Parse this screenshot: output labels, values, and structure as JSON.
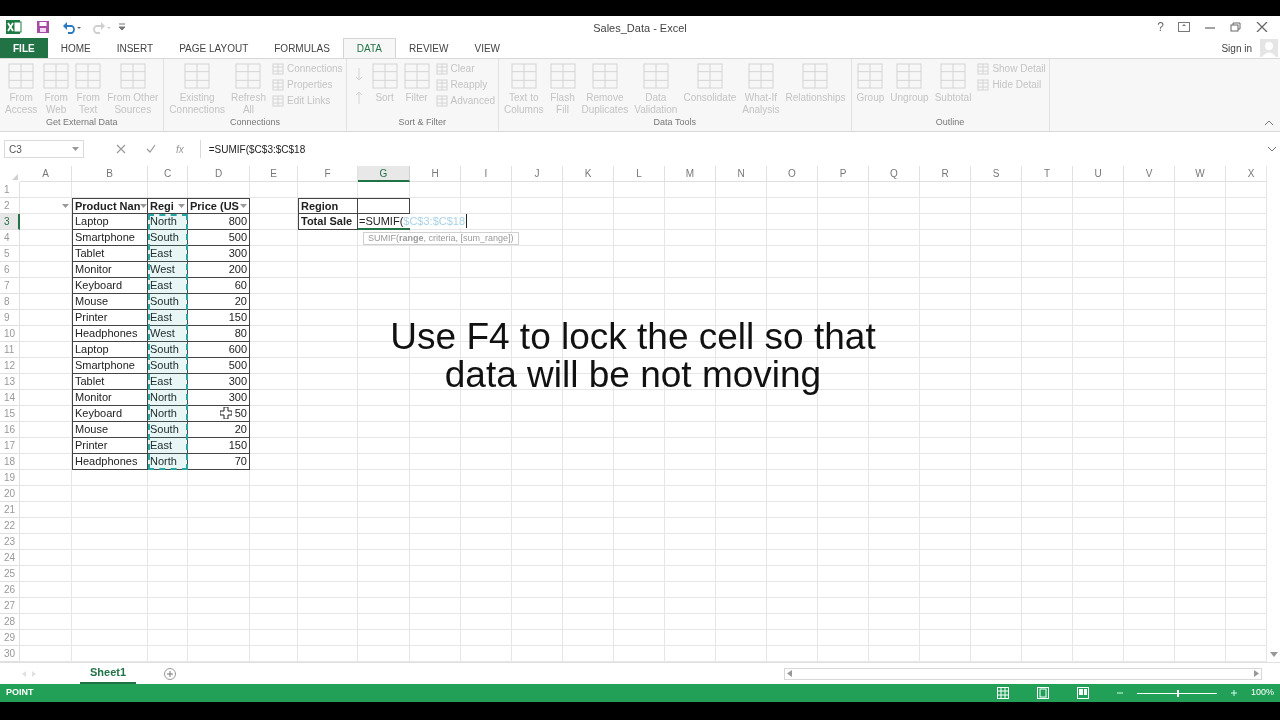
{
  "title_bar": {
    "title": "Sales_Data - Excel",
    "help": "?"
  },
  "ribbon_tabs": [
    {
      "label": "FILE",
      "kind": "file",
      "selected": false
    },
    {
      "label": "HOME",
      "kind": "tab",
      "selected": false
    },
    {
      "label": "INSERT",
      "kind": "tab",
      "selected": false
    },
    {
      "label": "PAGE LAYOUT",
      "kind": "tab",
      "selected": false
    },
    {
      "label": "FORMULAS",
      "kind": "tab",
      "selected": false
    },
    {
      "label": "DATA",
      "kind": "tab",
      "selected": true
    },
    {
      "label": "REVIEW",
      "kind": "tab",
      "selected": false
    },
    {
      "label": "VIEW",
      "kind": "tab",
      "selected": false
    }
  ],
  "sign_in": "Sign in",
  "ribbon_groups": [
    {
      "label": "Get External Data",
      "commands": [
        {
          "kind": "large",
          "label": "From\nAccess",
          "disabled": true
        },
        {
          "kind": "large",
          "label": "From\nWeb",
          "disabled": true
        },
        {
          "kind": "large",
          "label": "From\nText",
          "disabled": true
        },
        {
          "kind": "large",
          "label": "From Other\nSources",
          "disabled": true
        }
      ]
    },
    {
      "label": "Connections",
      "commands": [
        {
          "kind": "large",
          "label": "Existing\nConnections",
          "disabled": true
        },
        {
          "kind": "large",
          "label": "Refresh\nAll",
          "disabled": true
        },
        {
          "kind": "stack",
          "items": [
            {
              "label": "Connections",
              "disabled": true
            },
            {
              "label": "Properties",
              "disabled": true
            },
            {
              "label": "Edit Links",
              "disabled": true
            }
          ]
        }
      ]
    },
    {
      "label": "Sort & Filter",
      "commands": [
        {
          "kind": "sort_pair",
          "disabled": true
        },
        {
          "kind": "large",
          "label": "Sort",
          "disabled": true
        },
        {
          "kind": "large",
          "label": "Filter",
          "disabled": true
        },
        {
          "kind": "stack",
          "items": [
            {
              "label": "Clear",
              "disabled": true
            },
            {
              "label": "Reapply",
              "disabled": true
            },
            {
              "label": "Advanced",
              "disabled": true
            }
          ]
        }
      ]
    },
    {
      "label": "Data Tools",
      "commands": [
        {
          "kind": "large",
          "label": "Text to\nColumns",
          "disabled": true
        },
        {
          "kind": "large",
          "label": "Flash\nFill",
          "disabled": true
        },
        {
          "kind": "large",
          "label": "Remove\nDuplicates",
          "disabled": true
        },
        {
          "kind": "large",
          "label": "Data\nValidation",
          "disabled": true
        },
        {
          "kind": "large",
          "label": "Consolidate",
          "disabled": true
        },
        {
          "kind": "large",
          "label": "What-If\nAnalysis",
          "disabled": true
        },
        {
          "kind": "large",
          "label": "Relationships",
          "disabled": true
        }
      ]
    },
    {
      "label": "Outline",
      "commands": [
        {
          "kind": "large",
          "label": "Group",
          "disabled": true
        },
        {
          "kind": "large",
          "label": "Ungroup",
          "disabled": true
        },
        {
          "kind": "large",
          "label": "Subtotal",
          "disabled": true
        },
        {
          "kind": "stack",
          "items": [
            {
              "label": "Show Detail",
              "disabled": true
            },
            {
              "label": "Hide Detail",
              "disabled": true
            }
          ]
        }
      ]
    }
  ],
  "formula_bar": {
    "name_box": "C3",
    "function_button": "fx",
    "formula": "=SUMIF($C$3:$C$18"
  },
  "columns": [
    {
      "label": "A",
      "selected": false
    },
    {
      "label": "B",
      "selected": false
    },
    {
      "label": "C",
      "selected": false
    },
    {
      "label": "D",
      "selected": false
    },
    {
      "label": "E",
      "selected": false
    },
    {
      "label": "F",
      "selected": false
    },
    {
      "label": "G",
      "selected": true
    },
    {
      "label": "H",
      "selected": false
    },
    {
      "label": "I",
      "selected": false
    },
    {
      "label": "J",
      "selected": false
    },
    {
      "label": "K",
      "selected": false
    },
    {
      "label": "L",
      "selected": false
    },
    {
      "label": "M",
      "selected": false
    },
    {
      "label": "N",
      "selected": false
    },
    {
      "label": "O",
      "selected": false
    },
    {
      "label": "P",
      "selected": false
    },
    {
      "label": "Q",
      "selected": false
    },
    {
      "label": "R",
      "selected": false
    },
    {
      "label": "S",
      "selected": false
    },
    {
      "label": "T",
      "selected": false
    },
    {
      "label": "U",
      "selected": false
    },
    {
      "label": "V",
      "selected": false
    },
    {
      "label": "W",
      "selected": false
    },
    {
      "label": "X",
      "selected": false
    }
  ],
  "rows": [
    {
      "label": "1",
      "selected": false
    },
    {
      "label": "2",
      "selected": false
    },
    {
      "label": "3",
      "selected": true
    },
    {
      "label": "4",
      "selected": false
    },
    {
      "label": "5",
      "selected": false
    },
    {
      "label": "6",
      "selected": false
    },
    {
      "label": "7",
      "selected": false
    },
    {
      "label": "8",
      "selected": false
    },
    {
      "label": "9",
      "selected": false
    },
    {
      "label": "10",
      "selected": false
    },
    {
      "label": "11",
      "selected": false
    },
    {
      "label": "12",
      "selected": false
    },
    {
      "label": "13",
      "selected": false
    },
    {
      "label": "14",
      "selected": false
    },
    {
      "label": "15",
      "selected": false
    },
    {
      "label": "16",
      "selected": false
    },
    {
      "label": "17",
      "selected": false
    },
    {
      "label": "18",
      "selected": false
    },
    {
      "label": "19",
      "selected": false
    },
    {
      "label": "20",
      "selected": false
    },
    {
      "label": "21",
      "selected": false
    },
    {
      "label": "22",
      "selected": false
    },
    {
      "label": "23",
      "selected": false
    },
    {
      "label": "24",
      "selected": false
    },
    {
      "label": "25",
      "selected": false
    },
    {
      "label": "26",
      "selected": false
    },
    {
      "label": "27",
      "selected": false
    },
    {
      "label": "28",
      "selected": false
    },
    {
      "label": "29",
      "selected": false
    },
    {
      "label": "30",
      "selected": false
    }
  ],
  "table": {
    "columns": [
      {
        "label": "Product Nan",
        "kind": "text",
        "marquee": false
      },
      {
        "label": "Regi",
        "kind": "text",
        "marquee": true
      },
      {
        "label": "Price (US",
        "kind": "number",
        "marquee": false
      }
    ],
    "rows": [
      [
        "Laptop",
        "North",
        "800"
      ],
      [
        "Smartphone",
        "South",
        "500"
      ],
      [
        "Tablet",
        "East",
        "300"
      ],
      [
        "Monitor",
        "West",
        "200"
      ],
      [
        "Keyboard",
        "East",
        "60"
      ],
      [
        "Mouse",
        "South",
        "20"
      ],
      [
        "Printer",
        "East",
        "150"
      ],
      [
        "Headphones",
        "West",
        "80"
      ],
      [
        "Laptop",
        "South",
        "600"
      ],
      [
        "Smartphone",
        "South",
        "500"
      ],
      [
        "Tablet",
        "East",
        "300"
      ],
      [
        "Monitor",
        "North",
        "300"
      ],
      [
        "Keyboard",
        "North",
        "50"
      ],
      [
        "Mouse",
        "South",
        "20"
      ],
      [
        "Printer",
        "East",
        "150"
      ],
      [
        "Headphones",
        "North",
        "70"
      ]
    ]
  },
  "lookup": [
    {
      "label": "Region",
      "kind": "input"
    },
    {
      "label": "Total Sale",
      "kind": "editing",
      "formula": "=SUMIF(",
      "reference": "$C$3:$C$18"
    }
  ],
  "function_tooltip": "SUMIF(**range**, criteria, [sum_range])",
  "caption": [
    "Use F4 to lock the cell so that",
    "data will be not moving"
  ],
  "sheet_tabs": [
    {
      "label": "Sheet1",
      "selected": true
    }
  ],
  "status_bar": {
    "mode": "POINT",
    "zoom": "100%",
    "zoom_slider": {
      "level": 0.5
    }
  }
}
